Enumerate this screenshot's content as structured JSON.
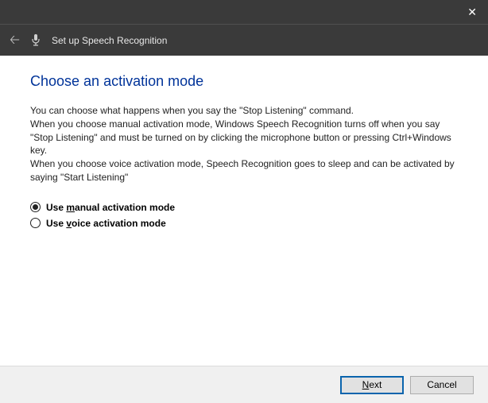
{
  "window": {
    "title": "Set up Speech Recognition"
  },
  "page": {
    "title": "Choose an activation mode",
    "desc_line1": "You can choose what happens when you say the \"Stop Listening\" command.",
    "desc_line2": "When you choose manual activation mode, Windows Speech Recognition turns off when you say \"Stop Listening\" and must be turned on by clicking the microphone button or pressing Ctrl+Windows key.",
    "desc_line3": "When you choose voice activation mode, Speech Recognition goes to sleep and can be activated by saying \"Start Listening\""
  },
  "options": {
    "manual": {
      "pre": "Use ",
      "accel": "m",
      "post": "anual activation mode",
      "selected": true
    },
    "voice": {
      "pre": "Use ",
      "accel": "v",
      "post": "oice activation mode",
      "selected": false
    }
  },
  "buttons": {
    "next": {
      "accel": "N",
      "rest": "ext"
    },
    "cancel": "Cancel"
  }
}
